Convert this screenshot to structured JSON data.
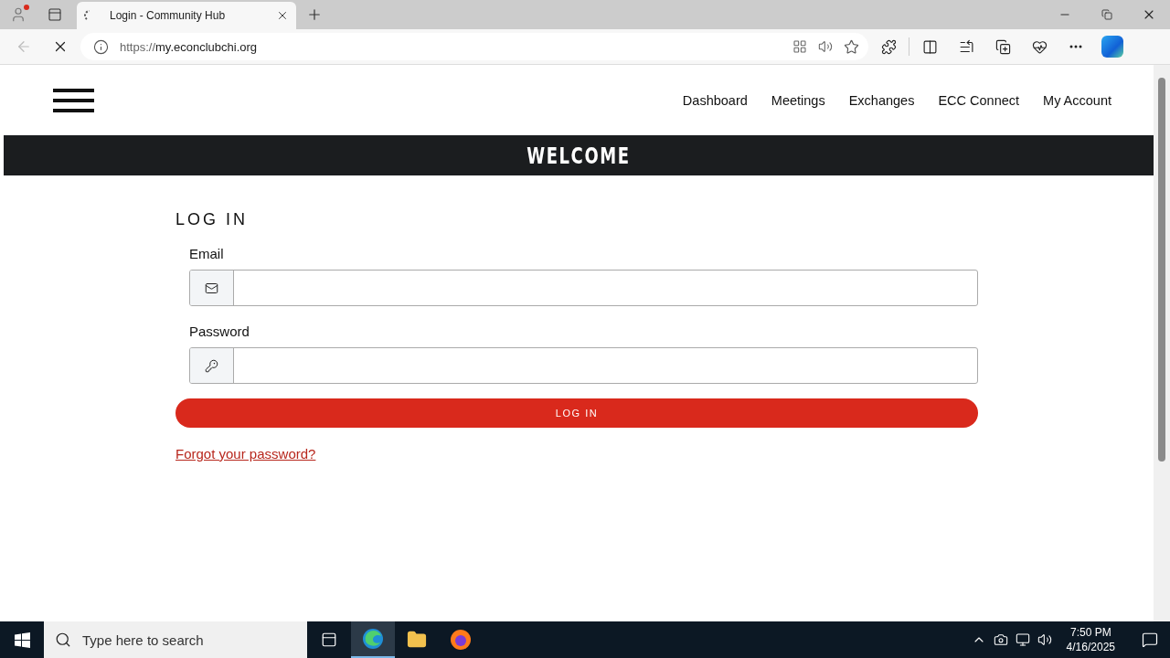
{
  "browser": {
    "tab_title": "Login - Community Hub",
    "url_scheme": "https://",
    "url_host": "my.econclubchi.org"
  },
  "nav": {
    "items": [
      "Dashboard",
      "Meetings",
      "Exchanges",
      "ECC Connect",
      "My Account"
    ]
  },
  "banner": {
    "title": "WELCOME"
  },
  "login": {
    "heading": "LOG IN",
    "fields": [
      {
        "label": "Email",
        "kind": "email"
      },
      {
        "label": "Password",
        "kind": "password"
      }
    ],
    "button": "LOG IN",
    "forgot_link": "Forgot your password?"
  },
  "taskbar": {
    "search_placeholder": "Type here to search",
    "time": "7:50 PM",
    "date": "4/16/2025"
  }
}
